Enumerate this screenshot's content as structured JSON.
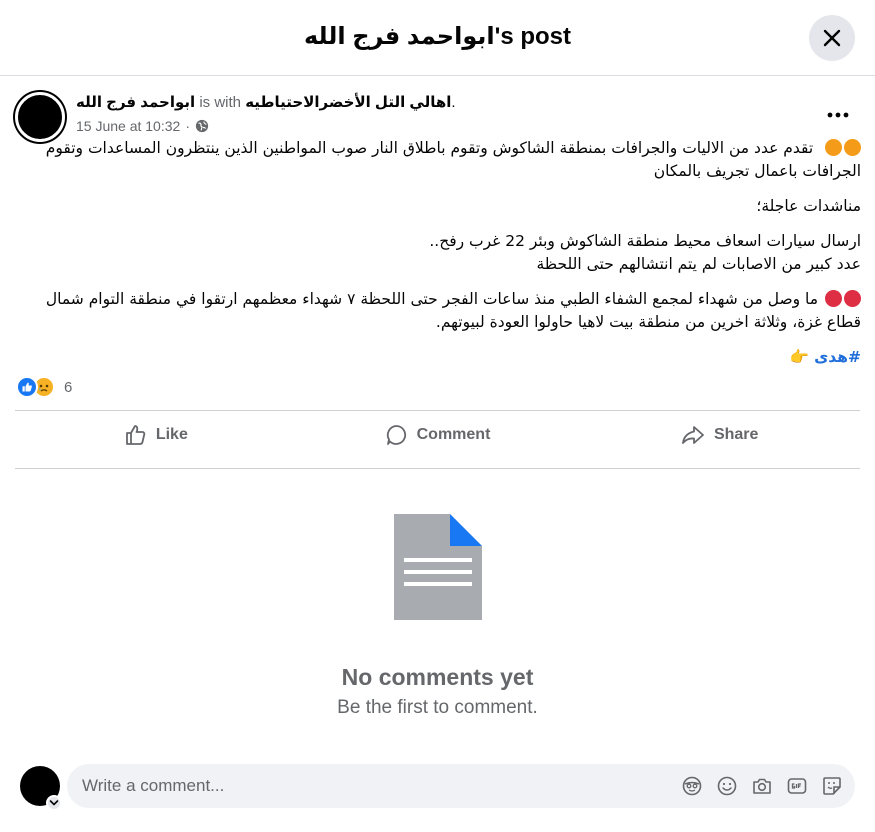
{
  "header": {
    "title": "ابواحمد فرج الله's post",
    "close_icon": "close-icon"
  },
  "post": {
    "author": "ابواحمد فرج الله",
    "is_with": "is with",
    "tagged_group": "اهالي التل الأخضرالاحتياطيه",
    "trailing_period": ".",
    "timestamp": "15 June at 10:32",
    "separator": "·",
    "audience_icon": "globe-icon",
    "more_icon": "more-options-icon",
    "colors": {
      "orange_dot": "#f59b1a",
      "red_dot": "#dd2e44",
      "hashtag": "#216fdb"
    },
    "paragraph_1": "تقدم عدد من الاليات والجرافات بمنطقة الشاكوش وتقوم باطلاق النار صوب المواطنين الذين ينتظرون المساعدات وتقوم الجرافات باعمال تجريف بالمكان",
    "paragraph_2": "مناشدات عاجلة؛",
    "paragraph_3_line_1": "ارسال سيارات اسعاف محيط منطقة الشاكوش وبئر 22 غرب رفح..",
    "paragraph_3_line_2": "عدد كبير من الاصابات لم يتم انتشالهم حتى اللحظة",
    "paragraph_4": "ما وصل من شهداء لمجمع الشفاء الطبي منذ ساعات الفجر حتى اللحظة ٧ شهداء معظمهم ارتقوا في منطقة التوام شمال قطاع غزة، وثلاثة اخرين من منطقة بيت لاهيا حاولوا العودة لبيوتهم.",
    "hashtag": "#هدى",
    "hashtag_emoji": "👉"
  },
  "reactions": {
    "icons": [
      "like-reaction-icon",
      "sad-reaction-icon"
    ],
    "count": "6"
  },
  "actions": {
    "like": "Like",
    "comment": "Comment",
    "share": "Share"
  },
  "comments": {
    "empty_icon": "document-icon",
    "empty_title": "No comments yet",
    "empty_subtitle": "Be the first to comment."
  },
  "composer": {
    "placeholder": "Write a comment...",
    "tools": [
      "avatar-sticker-icon",
      "emoji-icon",
      "camera-icon",
      "gif-icon",
      "sticker-icon"
    ]
  }
}
